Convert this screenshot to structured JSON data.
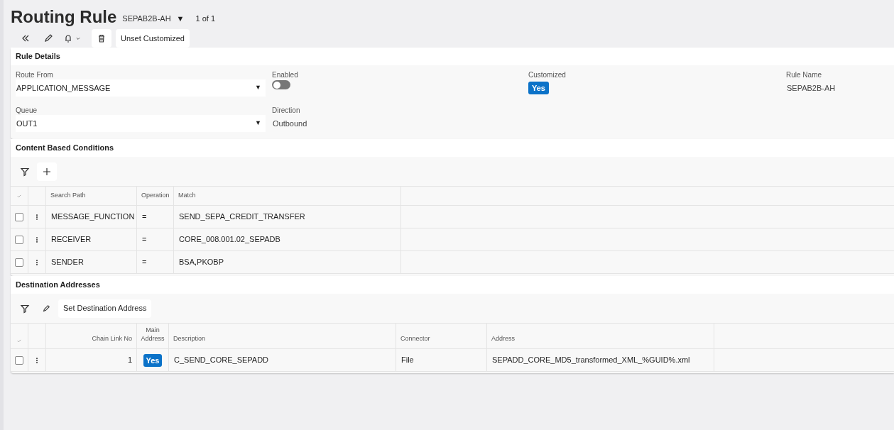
{
  "header": {
    "title": "Routing Rule",
    "record": "SEPAB2B-AH",
    "caret": "▼",
    "counter": "1 of 1"
  },
  "toolbar": {
    "buttons": [
      "Unset Customized"
    ]
  },
  "rule_details": {
    "title": "Rule Details",
    "fields": [
      {
        "kind": "select",
        "label": "Route From",
        "value": "APPLICATION_MESSAGE",
        "caret": "▼"
      },
      {
        "kind": "toggle",
        "label": "Enabled",
        "on": false
      },
      {
        "kind": "badge",
        "label": "Customized",
        "value": "Yes"
      },
      {
        "kind": "text",
        "label": "Rule Name",
        "value": "SEPAB2B-AH"
      },
      {
        "kind": "select",
        "label": "Queue",
        "value": "OUT1",
        "caret": "▼"
      },
      {
        "kind": "text",
        "label": "Direction",
        "value": "Outbound"
      }
    ]
  },
  "conditions": {
    "title": "Content Based Conditions",
    "columns": [
      "Search Path",
      "Operation",
      "Match"
    ],
    "rows": [
      {
        "checked": false,
        "cells": [
          "MESSAGE_FUNCTION",
          "=",
          "SEND_SEPA_CREDIT_TRANSFER"
        ]
      },
      {
        "checked": false,
        "cells": [
          "RECEIVER",
          "=",
          "CORE_008.001.02_SEPADB"
        ]
      },
      {
        "checked": false,
        "cells": [
          "SENDER",
          "=",
          "BSA,PKOBP"
        ]
      }
    ]
  },
  "destinations": {
    "title": "Destination Addresses",
    "toolbar_button": "Set Destination Address",
    "columns": [
      "Chain Link No",
      "Main Address",
      "Description",
      "Connector",
      "Address"
    ],
    "rows": [
      {
        "checked": false,
        "chain_link_no": "1",
        "main_address": "Yes",
        "description": "C_SEND_CORE_SEPADD",
        "connector": "File",
        "address": "SEPADD_CORE_MD5_transformed_XML_%GUID%.xml"
      }
    ]
  }
}
